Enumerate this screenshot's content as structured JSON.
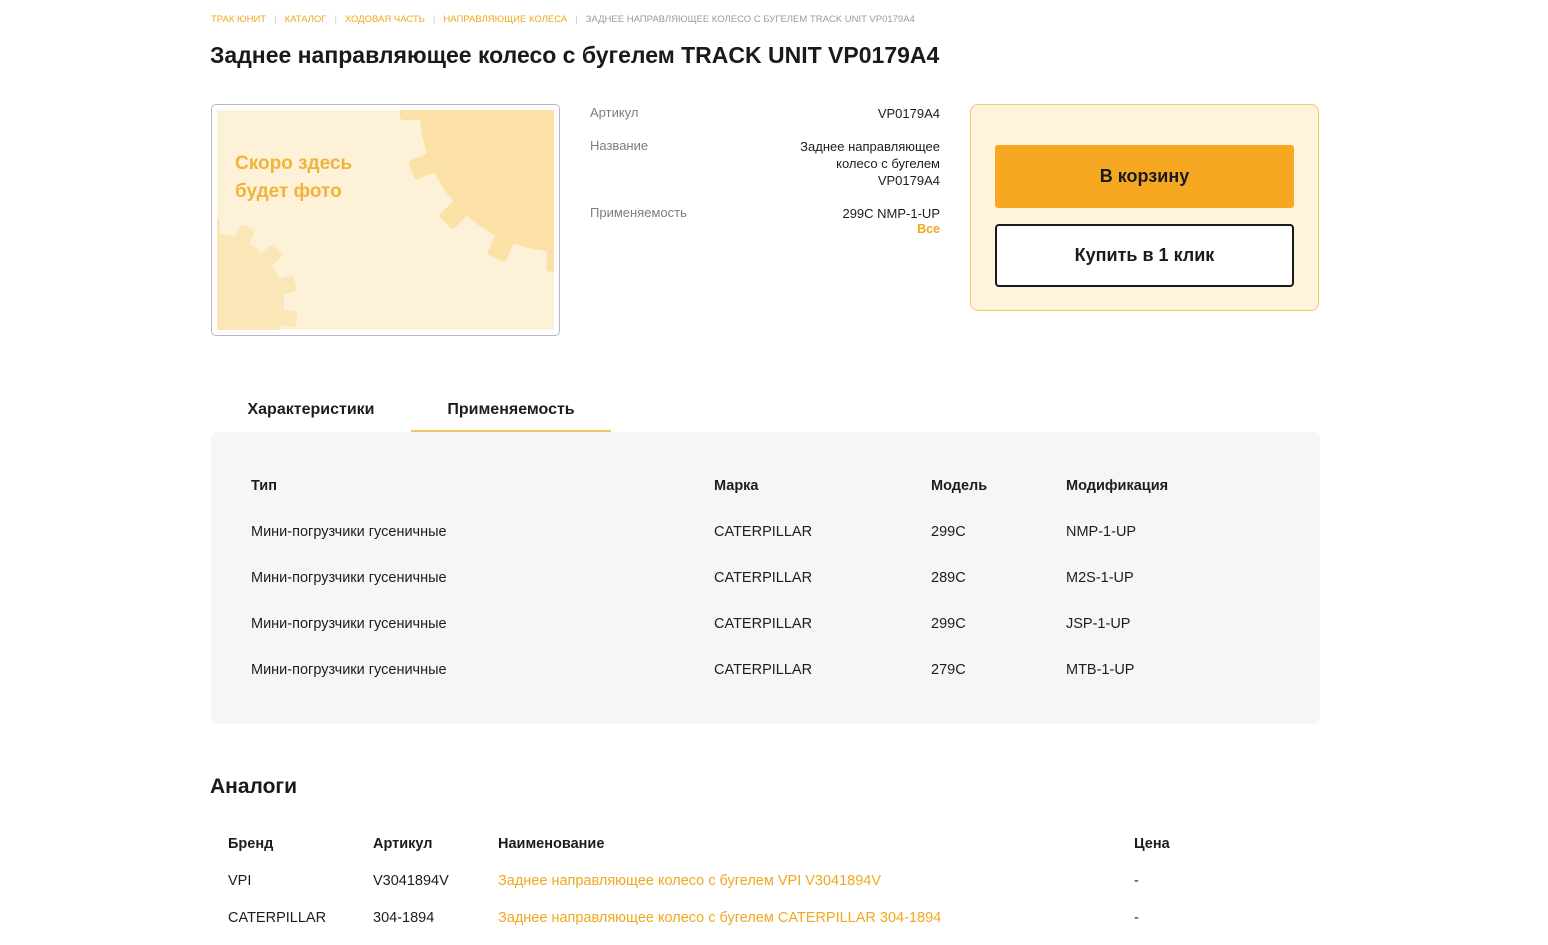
{
  "breadcrumb": {
    "items": [
      "ТРАК ЮНИТ",
      "КАТАЛОГ",
      "ХОДОВАЯ ЧАСТЬ",
      "НАПРАВЛЯЮЩИЕ КОЛЕСА"
    ],
    "current": "ЗАДНЕЕ НАПРАВЛЯЮЩЕЕ КОЛЕСО С БУГЕЛЕМ TRACK UNIT VP0179A4"
  },
  "product": {
    "title": "Заднее направляющее колесо с бугелем TRACK UNIT VP0179A4",
    "photo_placeholder": [
      "Скоро здесь",
      "будет фото"
    ]
  },
  "specs": {
    "article_label": "Артикул",
    "article_value": "VP0179A4",
    "name_label": "Название",
    "name_lines": [
      "Заднее направляющее",
      "колесо с бугелем",
      "VP0179A4"
    ],
    "applicability_label": "Применяемость",
    "applicability_value": "299C NMP-1-UP",
    "all_link": "Все"
  },
  "buy": {
    "cart_label": "В корзину",
    "one_click_label": "Купить в 1 клик"
  },
  "tabs": [
    {
      "label": "Характеристики",
      "active": false
    },
    {
      "label": "Применяемость",
      "active": true
    }
  ],
  "applicability": {
    "headers": [
      "Тип",
      "Марка",
      "Модель",
      "Модификация"
    ],
    "rows": [
      [
        "Мини-погрузчики гусеничные",
        "CATERPILLAR",
        "299C",
        "NMP-1-UP"
      ],
      [
        "Мини-погрузчики гусеничные",
        "CATERPILLAR",
        "289C",
        "M2S-1-UP"
      ],
      [
        "Мини-погрузчики гусеничные",
        "CATERPILLAR",
        "299C",
        "JSP-1-UP"
      ],
      [
        "Мини-погрузчики гусеничные",
        "CATERPILLAR",
        "279C",
        "MTB-1-UP"
      ]
    ]
  },
  "analogs": {
    "title": "Аналоги",
    "headers": [
      "Бренд",
      "Артикул",
      "Наименование",
      "Цена"
    ],
    "rows": [
      [
        "VPI",
        "V3041894V",
        "Заднее направляющее колесо с бугелем VPI V3041894V",
        "-"
      ],
      [
        "CATERPILLAR",
        "304-1894",
        "Заднее направляющее колесо с бугелем CATERPILLAR 304-1894",
        "-"
      ]
    ]
  },
  "colors": {
    "accent": "#f7a823",
    "link": "#f0a81f",
    "panel_bg": "#f6f6f6",
    "buy_box_bg": "#fef4dc"
  }
}
